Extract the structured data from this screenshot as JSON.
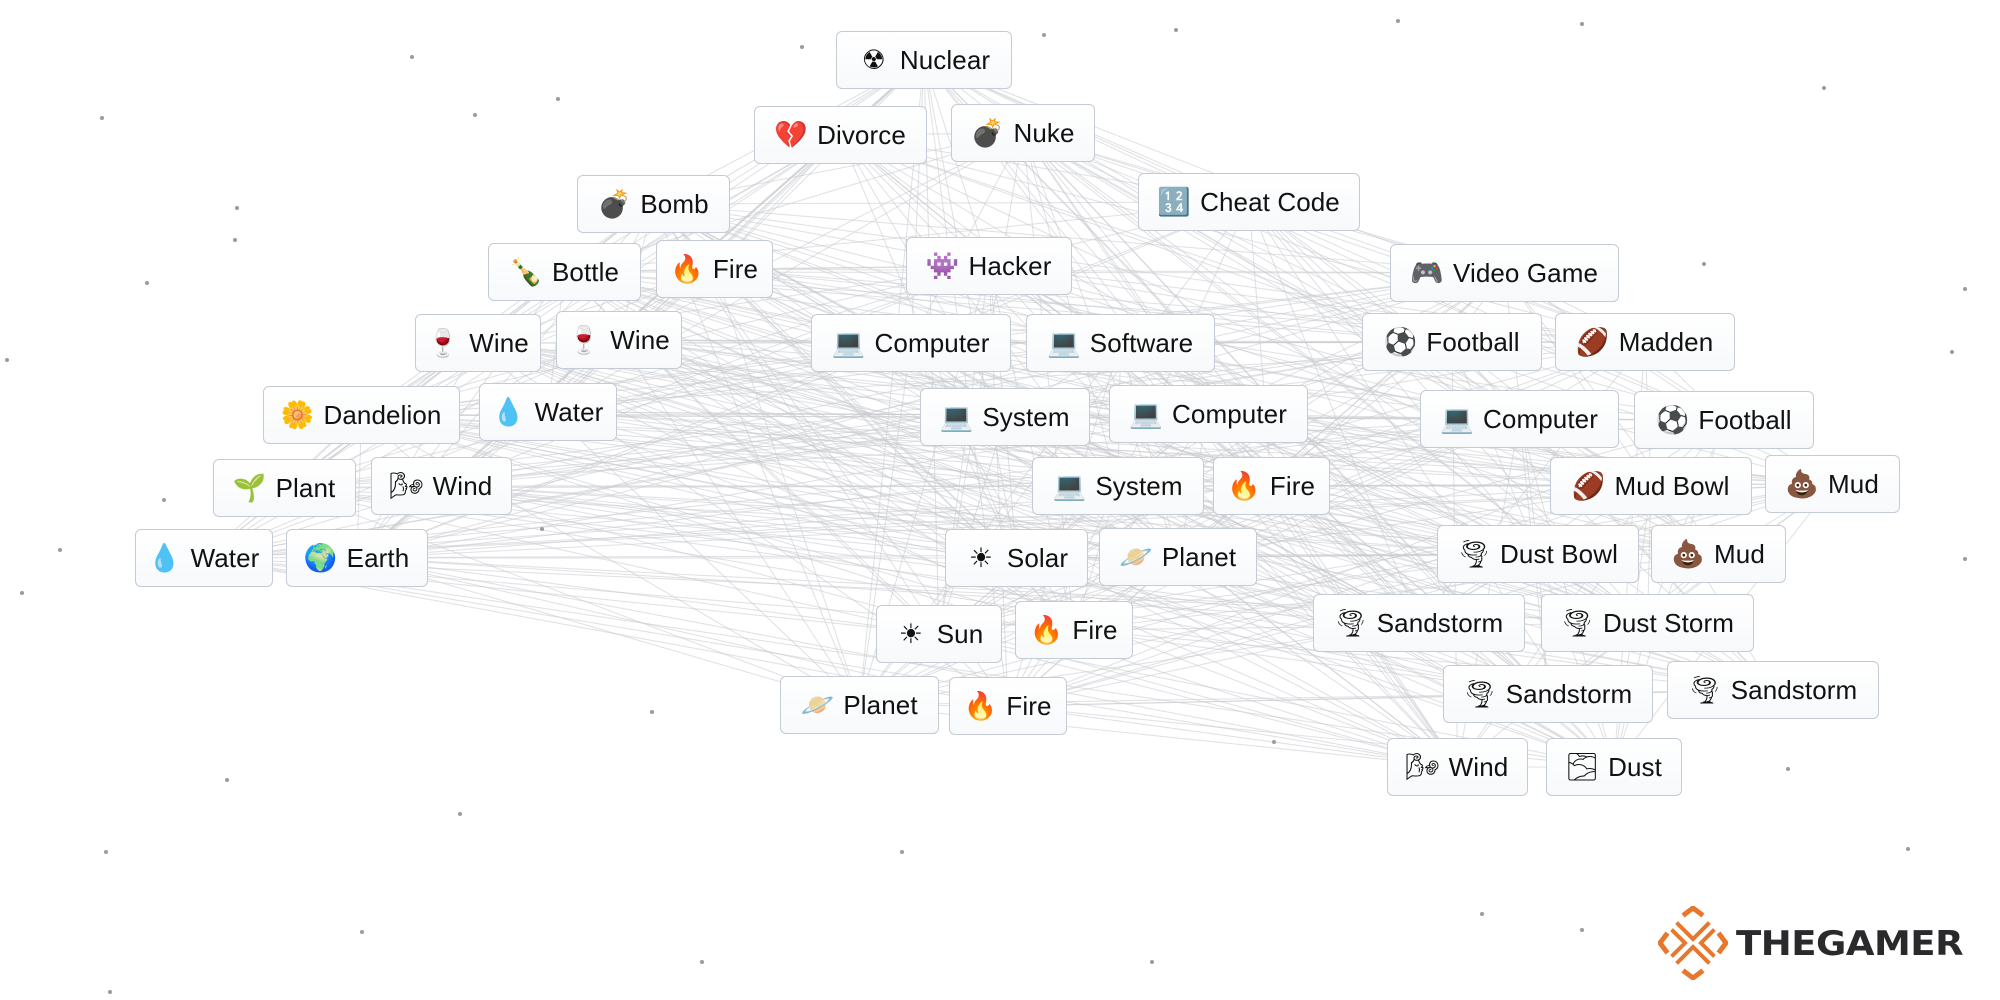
{
  "canvas": {
    "items": [
      {
        "id": "nuclear",
        "label": "Nuclear",
        "icon": "radioactive-icon"
      },
      {
        "id": "divorce",
        "label": "Divorce",
        "icon": "broken-heart-icon"
      },
      {
        "id": "nuke",
        "label": "Nuke",
        "icon": "bomb-icon"
      },
      {
        "id": "bomb",
        "label": "Bomb",
        "icon": "bomb-icon"
      },
      {
        "id": "cheat-code",
        "label": "Cheat Code",
        "icon": "input-numbers-icon"
      },
      {
        "id": "bottle",
        "label": "Bottle",
        "icon": "bottle-icon"
      },
      {
        "id": "fire-1",
        "label": "Fire",
        "icon": "fire-icon"
      },
      {
        "id": "hacker",
        "label": "Hacker",
        "icon": "alien-monster-icon"
      },
      {
        "id": "video-game",
        "label": "Video Game",
        "icon": "game-controller-icon"
      },
      {
        "id": "wine-1",
        "label": "Wine",
        "icon": "wine-glass-icon"
      },
      {
        "id": "wine-2",
        "label": "Wine",
        "icon": "wine-glass-icon"
      },
      {
        "id": "computer-1",
        "label": "Computer",
        "icon": "laptop-icon"
      },
      {
        "id": "software",
        "label": "Software",
        "icon": "laptop-icon"
      },
      {
        "id": "football-1",
        "label": "Football",
        "icon": "soccer-ball-icon"
      },
      {
        "id": "madden",
        "label": "Madden",
        "icon": "american-football-icon"
      },
      {
        "id": "dandelion",
        "label": "Dandelion",
        "icon": "blossom-icon"
      },
      {
        "id": "water-1",
        "label": "Water",
        "icon": "droplet-icon"
      },
      {
        "id": "system-1",
        "label": "System",
        "icon": "laptop-icon"
      },
      {
        "id": "computer-2",
        "label": "Computer",
        "icon": "laptop-icon"
      },
      {
        "id": "computer-3",
        "label": "Computer",
        "icon": "laptop-icon"
      },
      {
        "id": "football-2",
        "label": "Football",
        "icon": "soccer-ball-icon"
      },
      {
        "id": "plant",
        "label": "Plant",
        "icon": "seedling-icon"
      },
      {
        "id": "wind-1",
        "label": "Wind",
        "icon": "wind-face-icon"
      },
      {
        "id": "system-2",
        "label": "System",
        "icon": "laptop-icon"
      },
      {
        "id": "fire-2",
        "label": "Fire",
        "icon": "fire-icon"
      },
      {
        "id": "mud-bowl",
        "label": "Mud Bowl",
        "icon": "american-football-icon"
      },
      {
        "id": "mud-1",
        "label": "Mud",
        "icon": "pile-of-poo-icon"
      },
      {
        "id": "water-2",
        "label": "Water",
        "icon": "droplet-icon"
      },
      {
        "id": "earth",
        "label": "Earth",
        "icon": "globe-icon"
      },
      {
        "id": "solar",
        "label": "Solar",
        "icon": "sun-icon"
      },
      {
        "id": "planet-1",
        "label": "Planet",
        "icon": "ringed-planet-icon"
      },
      {
        "id": "dust-bowl",
        "label": "Dust Bowl",
        "icon": "tornado-icon"
      },
      {
        "id": "mud-2",
        "label": "Mud",
        "icon": "pile-of-poo-icon"
      },
      {
        "id": "sun",
        "label": "Sun",
        "icon": "sun-icon"
      },
      {
        "id": "fire-3",
        "label": "Fire",
        "icon": "fire-icon"
      },
      {
        "id": "sandstorm-1",
        "label": "Sandstorm",
        "icon": "tornado-icon"
      },
      {
        "id": "dust-storm",
        "label": "Dust Storm",
        "icon": "tornado-icon"
      },
      {
        "id": "planet-2",
        "label": "Planet",
        "icon": "ringed-planet-icon"
      },
      {
        "id": "fire-4",
        "label": "Fire",
        "icon": "fire-icon"
      },
      {
        "id": "sandstorm-2",
        "label": "Sandstorm",
        "icon": "tornado-icon"
      },
      {
        "id": "sandstorm-3",
        "label": "Sandstorm",
        "icon": "tornado-icon"
      },
      {
        "id": "wind-2",
        "label": "Wind",
        "icon": "wind-face-icon"
      },
      {
        "id": "dust",
        "label": "Dust",
        "icon": "fog-icon"
      }
    ]
  },
  "icons": {
    "radioactive-icon": "☢",
    "broken-heart-icon": "💔",
    "bomb-icon": "💣",
    "input-numbers-icon": "🔢",
    "bottle-icon": "🍾",
    "fire-icon": "🔥",
    "alien-monster-icon": "👾",
    "game-controller-icon": "🎮",
    "wine-glass-icon": "🍷",
    "laptop-icon": "💻",
    "soccer-ball-icon": "⚽",
    "american-football-icon": "🏈",
    "blossom-icon": "🌼",
    "droplet-icon": "💧",
    "seedling-icon": "🌱",
    "wind-face-icon": "🌬",
    "pile-of-poo-icon": "💩",
    "globe-icon": "🌍",
    "sun-icon": "☀",
    "ringed-planet-icon": "🪐",
    "tornado-icon": "🌪",
    "fog-icon": "🌫"
  },
  "watermark": {
    "text": "THEGAMER",
    "brand_color": "#e8772e"
  }
}
